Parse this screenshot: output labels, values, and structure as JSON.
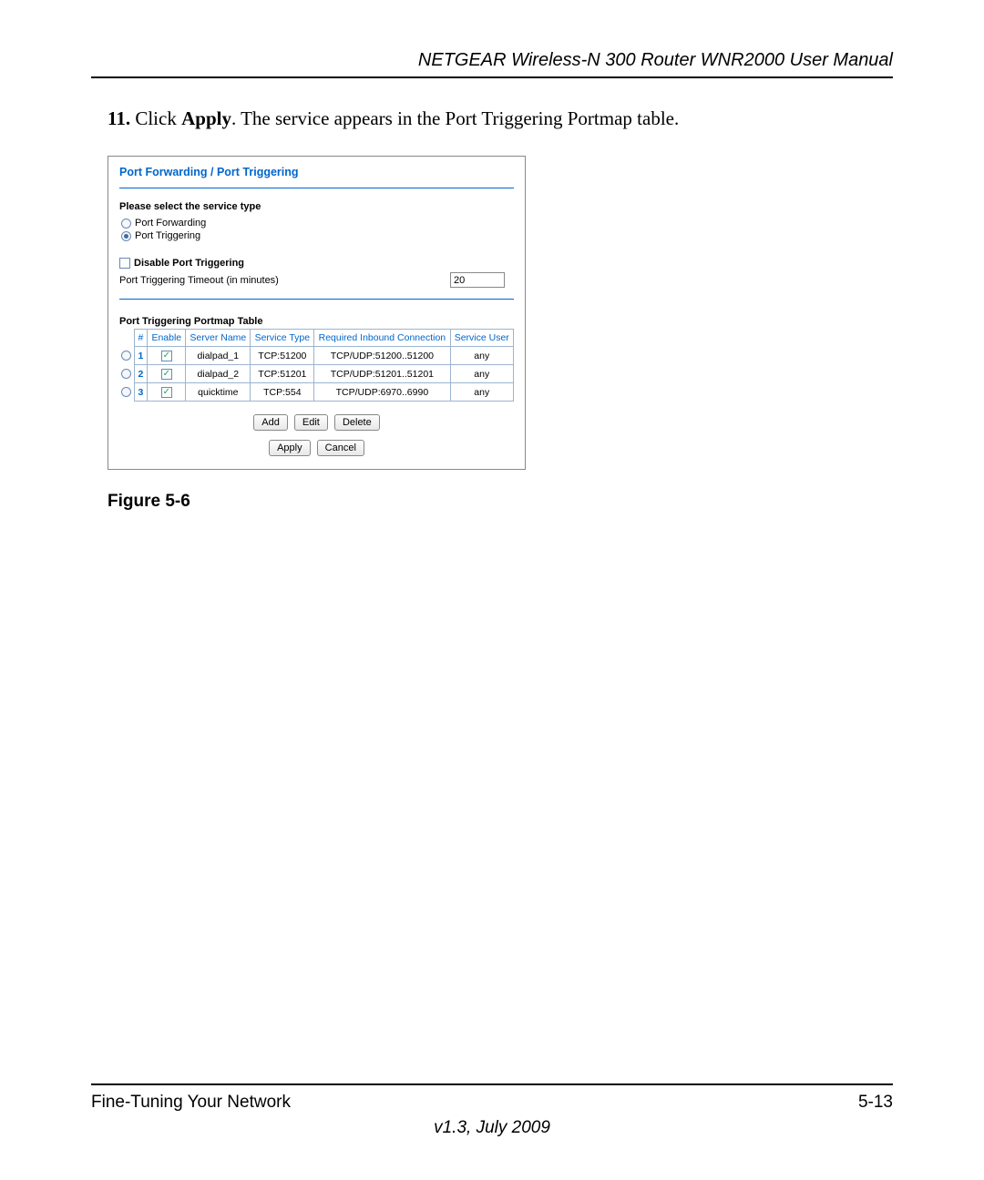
{
  "header": {
    "title": "NETGEAR Wireless-N 300 Router WNR2000 User Manual"
  },
  "instruction": {
    "number": "11.",
    "prefix": "Click ",
    "bold": "Apply",
    "suffix": ". The service appears in the Port Triggering Portmap table."
  },
  "panel": {
    "title": "Port Forwarding / Port Triggering",
    "select_label": "Please select the service type",
    "radios": {
      "forwarding": "Port Forwarding",
      "triggering": "Port Triggering"
    },
    "disable_label": "Disable Port Triggering",
    "timeout_label": "Port Triggering Timeout (in minutes)",
    "timeout_value": "20",
    "table_label": "Port Triggering Portmap Table",
    "columns": {
      "num": "#",
      "enable": "Enable",
      "server": "Server Name",
      "svc": "Service Type",
      "inbound": "Required Inbound Connection",
      "user": "Service User"
    },
    "rows": [
      {
        "n": "1",
        "server": "dialpad_1",
        "svc": "TCP:51200",
        "inbound": "TCP/UDP:51200..51200",
        "user": "any"
      },
      {
        "n": "2",
        "server": "dialpad_2",
        "svc": "TCP:51201",
        "inbound": "TCP/UDP:51201..51201",
        "user": "any"
      },
      {
        "n": "3",
        "server": "quicktime",
        "svc": "TCP:554",
        "inbound": "TCP/UDP:6970..6990",
        "user": "any"
      }
    ],
    "buttons": {
      "add": "Add",
      "edit": "Edit",
      "delete": "Delete",
      "apply": "Apply",
      "cancel": "Cancel"
    }
  },
  "figure_caption": "Figure 5-6",
  "footer": {
    "left": "Fine-Tuning Your Network",
    "right": "5-13",
    "version": "v1.3, July 2009"
  }
}
